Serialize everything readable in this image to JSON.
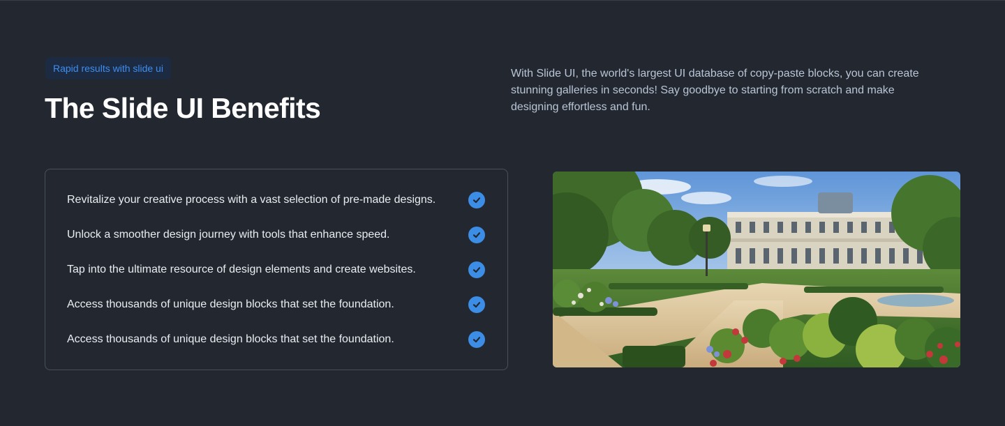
{
  "header": {
    "badge": "Rapid results with slide ui",
    "title": "The Slide UI Benefits",
    "intro": "With Slide UI, the world's largest UI database of copy-paste blocks, you can create stunning galleries in seconds! Say goodbye to starting from scratch and make designing effortless and fun."
  },
  "benefits": [
    "Revitalize your creative process with a vast selection of pre-made designs.",
    "Unlock a smoother design journey with tools that enhance speed.",
    "Tap into the ultimate resource of design elements and create websites.",
    "Access thousands of unique design blocks that set the foundation.",
    "Access thousands of unique design blocks that set the foundation."
  ],
  "icons": {
    "check": "check-circle-icon"
  },
  "colors": {
    "background": "#232830",
    "accent": "#3b8de6",
    "badge_text": "#3d8ef0",
    "badge_bg": "#1c2b42",
    "intro_text": "#b9c5d6",
    "card_border": "#4a505a"
  }
}
